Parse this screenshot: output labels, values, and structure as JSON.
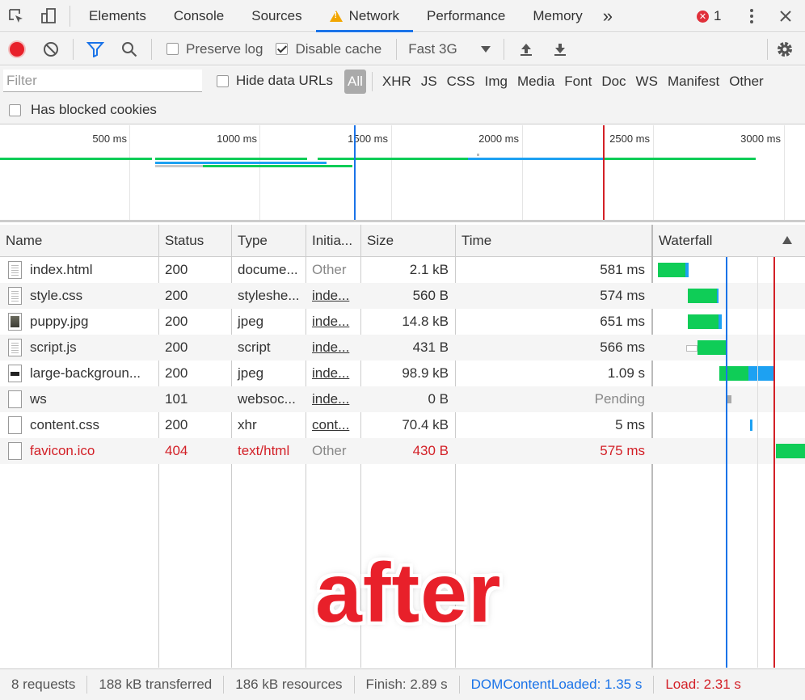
{
  "tabs": [
    "Elements",
    "Console",
    "Sources",
    "Network",
    "Performance",
    "Memory"
  ],
  "active_tab": "Network",
  "more_tabs": "»",
  "error_count": "1",
  "toolbar": {
    "preserve_log": "Preserve log",
    "preserve_log_checked": false,
    "disable_cache": "Disable cache",
    "disable_cache_checked": true,
    "throttle": "Fast 3G"
  },
  "filter": {
    "placeholder": "Filter",
    "hide_data_urls": "Hide data URLs",
    "types": [
      "All",
      "XHR",
      "JS",
      "CSS",
      "Img",
      "Media",
      "Font",
      "Doc",
      "WS",
      "Manifest",
      "Other"
    ],
    "selected_type": "All",
    "has_blocked_cookies": "Has blocked cookies"
  },
  "overview": {
    "ticks": [
      "500 ms",
      "1000 ms",
      "1500 ms",
      "2000 ms",
      "2500 ms",
      "3000 ms"
    ]
  },
  "columns": [
    "Name",
    "Status",
    "Type",
    "Initia...",
    "Size",
    "Time",
    "Waterfall"
  ],
  "rows": [
    {
      "name": "index.html",
      "status": "200",
      "type": "docume...",
      "initiator": "Other",
      "size": "2.1 kB",
      "time": "581 ms",
      "icon": "document-icon"
    },
    {
      "name": "style.css",
      "status": "200",
      "type": "styleshe...",
      "initiator": "inde...",
      "size": "560 B",
      "time": "574 ms",
      "icon": "document-icon"
    },
    {
      "name": "puppy.jpg",
      "status": "200",
      "type": "jpeg",
      "initiator": "inde...",
      "size": "14.8 kB",
      "time": "651 ms",
      "icon": "image-thumbnail-icon"
    },
    {
      "name": "script.js",
      "status": "200",
      "type": "script",
      "initiator": "inde...",
      "size": "431 B",
      "time": "566 ms",
      "icon": "document-icon"
    },
    {
      "name": "large-backgroun...",
      "status": "200",
      "type": "jpeg",
      "initiator": "inde...",
      "size": "98.9 kB",
      "time": "1.09 s",
      "icon": "image-thumbnail-icon"
    },
    {
      "name": "ws",
      "status": "101",
      "type": "websoc...",
      "initiator": "inde...",
      "size": "0 B",
      "time": "Pending",
      "icon": "blank-file-icon"
    },
    {
      "name": "content.css",
      "status": "200",
      "type": "xhr",
      "initiator": "cont...",
      "size": "70.4 kB",
      "time": "5 ms",
      "icon": "blank-file-icon"
    },
    {
      "name": "favicon.ico",
      "status": "404",
      "type": "text/html",
      "initiator": "Other",
      "size": "430 B",
      "time": "575 ms",
      "icon": "blank-file-icon"
    }
  ],
  "overlay_text": "after",
  "status": {
    "requests": "8 requests",
    "transferred": "188 kB transferred",
    "resources": "186 kB resources",
    "finish": "Finish: 2.89 s",
    "dom_content_loaded": "DOMContentLoaded: 1.35 s",
    "load": "Load: 2.31 s"
  },
  "colors": {
    "accent": "#1a73e8",
    "waiting": "#0fcd57",
    "download": "#1da1f2",
    "dcl_line": "#1a73e8",
    "load_line": "#d32027",
    "error_text": "#d32027"
  }
}
